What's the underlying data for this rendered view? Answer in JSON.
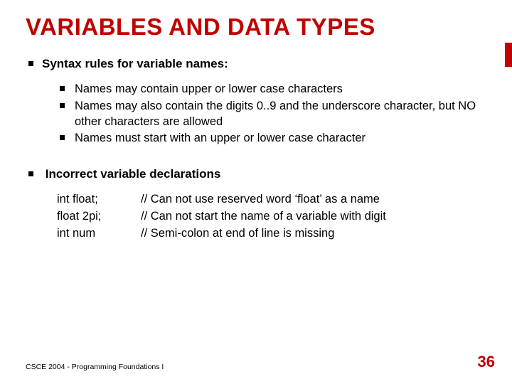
{
  "title": "VARIABLES AND DATA TYPES",
  "section1": {
    "heading": "Syntax rules for variable names:",
    "items": [
      "Names may contain upper or lower case characters",
      "Names may also contain the digits 0..9 and the underscore character, but NO other characters are allowed",
      "Names must start with an upper or lower case character"
    ]
  },
  "section2": {
    "heading": "Incorrect variable declarations",
    "rows": [
      {
        "decl": "int float;",
        "comment": "// Can not use reserved word ‘float’ as a name"
      },
      {
        "decl": "float 2pi;",
        "comment": "// Can not start the name of a variable with digit"
      },
      {
        "decl": "int num",
        "comment": "// Semi-colon at end of line is missing"
      }
    ]
  },
  "footer": "CSCE 2004 - Programming Foundations I",
  "page": "36"
}
